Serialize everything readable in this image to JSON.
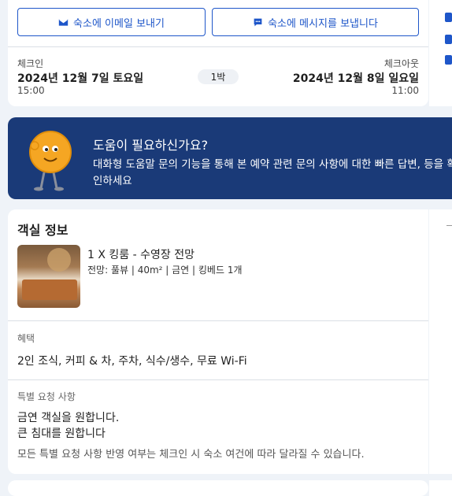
{
  "contact": {
    "email_button": "숙소에 이메일 보내기",
    "message_button": "숙소에 메시지를 보냅니다"
  },
  "stay": {
    "checkin_label": "체크인",
    "checkin_date": "2024년 12월 7일 토요일",
    "checkin_time": "15:00",
    "nights": "1박",
    "checkout_label": "체크아웃",
    "checkout_date": "2024년 12월 8일 일요일",
    "checkout_time": "11:00"
  },
  "help": {
    "title": "도움이 필요하신가요?",
    "description": "대화형 도움말 문의 기능을 통해 본 예약 관련 문의 사항에 대한 빠른 답변, 등을 확인하세요"
  },
  "room": {
    "heading": "객실 정보",
    "name": "1 X 킹룸 - 수영장 전망",
    "details": "전망: 풀뷰 | 40m² | 금연 | 킹베드 1개",
    "benefits_label": "혜택",
    "benefits": "2인 조식, 커피 & 차, 주차, 식수/생수, 무료 Wi-Fi",
    "requests_label": "특별 요청 사항",
    "request_1": "금연 객실을 원합니다.",
    "request_2": "큰 침대를 원합니다",
    "requests_note": "모든 특별 요청 사항 반영 여부는 체크인 시 숙소 여건에 따라 달라질 수 있습니다."
  },
  "colors": {
    "accent": "#1e56c9",
    "banner": "#1a3a78",
    "background": "#eff3f8"
  }
}
